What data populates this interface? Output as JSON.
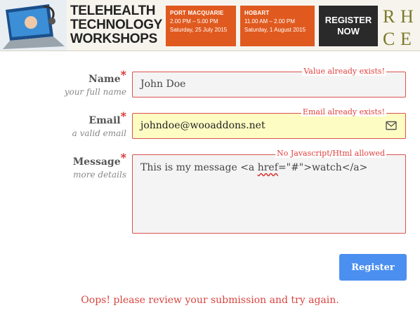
{
  "banner": {
    "title_lines": [
      "TELEHEALTH",
      "TECHNOLOGY",
      "WORKSHOPS"
    ],
    "events": [
      {
        "city": "PORT MACQUARIE",
        "time": "2.00 PM – 5.00 PM",
        "date": "Saturday, 25 July 2015"
      },
      {
        "city": "HOBART",
        "time": "11.00 AM – 2.00 PM",
        "date": "Saturday, 1 August 2015"
      }
    ],
    "register_lines": [
      "REGISTER",
      "NOW"
    ],
    "logo_letters": "RHCE",
    "colors": {
      "event_bg": "#e05a1f",
      "register_bg": "#2a2a2a",
      "logo": "#7a7a28"
    }
  },
  "form": {
    "name": {
      "label": "Name",
      "required_mark": "*",
      "hint": "your full name",
      "value": "John Doe",
      "error": "Value already exists!"
    },
    "email": {
      "label": "Email",
      "required_mark": "*",
      "hint": "a valid email",
      "value": "johndoe@wooaddons.net",
      "error": "Email already exists!",
      "icon": "envelope-icon"
    },
    "message": {
      "label": "Message",
      "required_mark": "*",
      "hint": "more details",
      "value_prefix": "This is my message <a ",
      "value_spell": "href",
      "value_suffix": "=\"#\">watch</a>",
      "error": "No Javascript/Html allowed"
    },
    "submit_label": "Register",
    "alert": "Oops! please review your submission and try again.",
    "colors": {
      "error": "#d9534f",
      "submit": "#4b8ff0",
      "email_autofill": "#fdfdc3"
    }
  }
}
